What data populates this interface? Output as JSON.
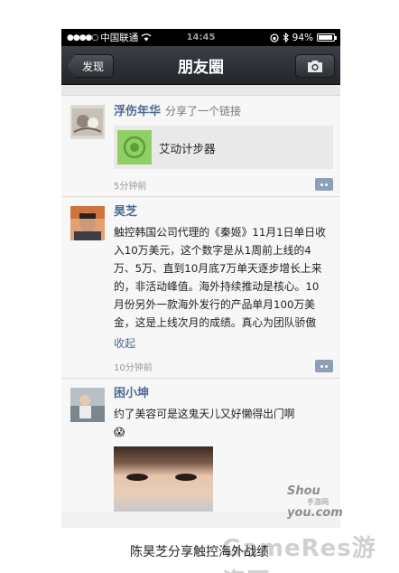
{
  "status_bar": {
    "signal": "●●●●○",
    "carrier": "中国联通",
    "time": "14:45",
    "battery_text": "94%",
    "battery_level": 0.94
  },
  "navbar": {
    "back_label": "发现",
    "title": "朋友圈"
  },
  "posts": [
    {
      "name": "浮伤年华",
      "action": "分享了一个链接",
      "link_title": "艾动计步器",
      "time": "5分钟前"
    },
    {
      "name": "昊芝",
      "text": "触控韩国公司代理的《秦姬》11月1日单日收入10万美元，这个数字是从1周前上线的4万、5万、直到10月底7万单天逐步增长上来的，非活动峰值。海外持续推动是核心。10月份另外一款海外发行的产品单月100万美金，这是上线次月的成绩。真心为团队骄傲",
      "collapse": "收起",
      "time": "10分钟前"
    },
    {
      "name": "困小坤",
      "text": "约了美容可是这鬼天儿又好懒得出门啊",
      "emoji": "😱"
    }
  ],
  "watermark": {
    "logo": "Shou",
    "logo_sub": "手游网",
    "logo2": "you.com",
    "site": "GameRes游资网"
  },
  "caption": "陈昊芝分享触控海外战绩"
}
